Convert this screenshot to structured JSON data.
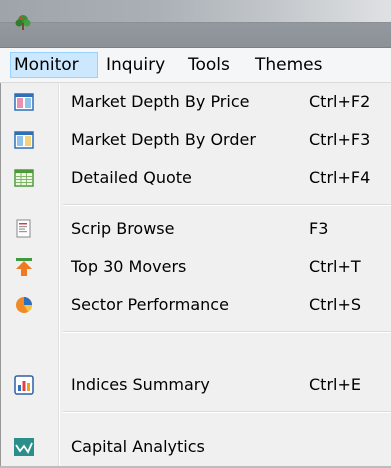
{
  "window": {
    "app_icon": "tree-logo-icon"
  },
  "menubar": {
    "items": [
      {
        "label": "Monitor"
      },
      {
        "label": "Inquiry"
      },
      {
        "label": "Tools"
      },
      {
        "label": "Themes"
      }
    ]
  },
  "dropdown": {
    "items": [
      {
        "label": "Market Depth By Price",
        "shortcut": "Ctrl+F2",
        "icon": "market-depth-price-icon"
      },
      {
        "label": "Market Depth By Order",
        "shortcut": "Ctrl+F3",
        "icon": "market-depth-order-icon"
      },
      {
        "label": "Detailed Quote",
        "shortcut": "Ctrl+F4",
        "icon": "spreadsheet-icon"
      },
      {
        "label": "Scrip Browse",
        "shortcut": "F3",
        "icon": "browse-document-icon"
      },
      {
        "label": "Top 30 Movers",
        "shortcut": "Ctrl+T",
        "icon": "top-movers-arrow-icon"
      },
      {
        "label": "Sector Performance",
        "shortcut": "Ctrl+S",
        "icon": "pie-chart-icon"
      },
      {
        "label": "Indices Summary",
        "shortcut": "Ctrl+E",
        "icon": "bar-chart-icon"
      },
      {
        "label": "Capital Analytics",
        "shortcut": "",
        "icon": "line-chart-icon"
      }
    ]
  },
  "colors": {
    "menu_active_bg": "#cce8ff",
    "menu_active_border": "#99d1ff",
    "titlebar": "#8b9197"
  }
}
